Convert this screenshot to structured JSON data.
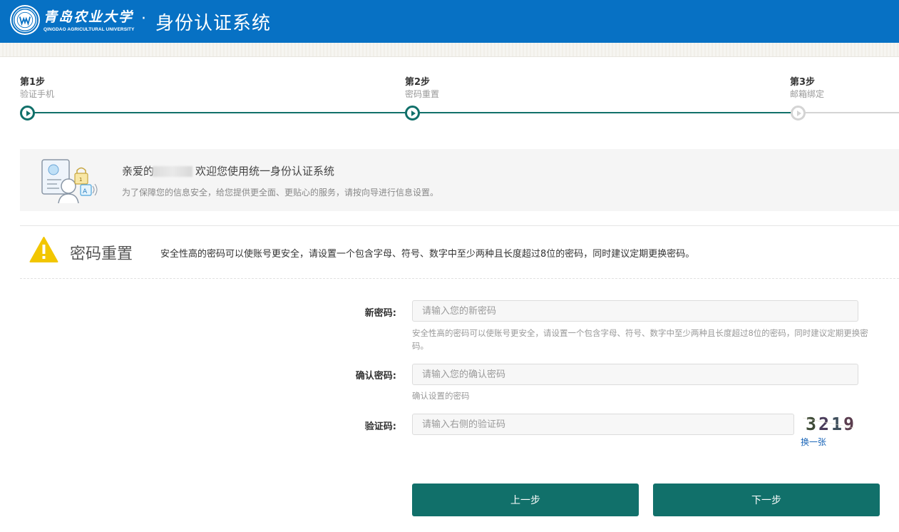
{
  "header": {
    "logo_cn": "青岛农业大学",
    "logo_en": "QINGDAO AGRICULTURAL UNIVERSITY",
    "separator": "·",
    "system_title": "身份认证系统",
    "background_color": "#0771c4"
  },
  "steps": [
    {
      "label": "第1步",
      "sub": "验证手机",
      "status": "done"
    },
    {
      "label": "第2步",
      "sub": "密码重置",
      "status": "current"
    },
    {
      "label": "第3步",
      "sub": "邮箱绑定",
      "status": "pending"
    }
  ],
  "welcome": {
    "greeting_prefix": "亲爱的",
    "greeting_suffix": "欢迎您使用统一身份认证系统",
    "subtitle": "为了保障您的信息安全，给您提供更全面、更贴心的服务，请按向导进行信息设置。"
  },
  "section": {
    "title": "密码重置",
    "description": "安全性高的密码可以使账号更安全，请设置一个包含字母、符号、数字中至少两种且长度超过8位的密码，同时建议定期更换密码。"
  },
  "form": {
    "new_password": {
      "label": "新密码:",
      "placeholder": "请输入您的新密码",
      "value": "",
      "help": "安全性高的密码可以使账号更安全，请设置一个包含字母、符号、数字中至少两种且长度超过8位的密码，同时建议定期更换密码。"
    },
    "confirm_password": {
      "label": "确认密码:",
      "placeholder": "请输入您的确认密码",
      "value": "",
      "help": "确认设置的密码"
    },
    "captcha": {
      "label": "验证码:",
      "placeholder": "请输入右侧的验证码",
      "value": "",
      "image_text": "3219",
      "refresh_label": "换一张"
    }
  },
  "buttons": {
    "prev": "上一步",
    "next": "下一步"
  },
  "colors": {
    "accent": "#11706a",
    "link": "#1b66b8",
    "warning": "#f2c600"
  }
}
